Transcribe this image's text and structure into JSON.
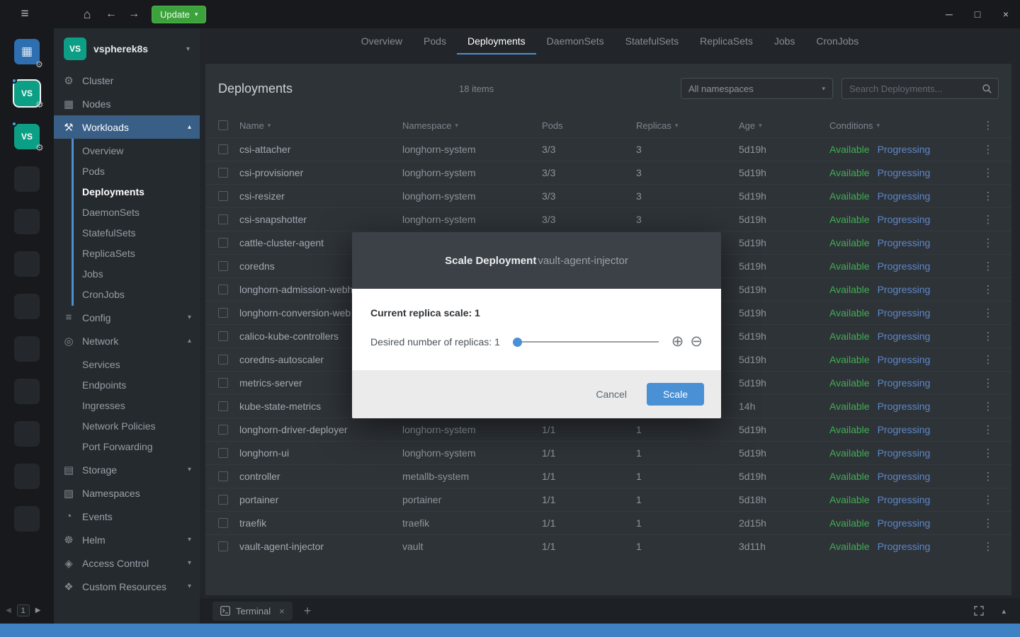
{
  "topbar": {
    "update_label": "Update"
  },
  "rail": {
    "active_cluster": "VS",
    "second_cluster": "VS",
    "page_number": "1"
  },
  "sidebar": {
    "cluster_initials": "VS",
    "cluster_name": "vspherek8s",
    "items": [
      {
        "id": "cluster",
        "label": "Cluster",
        "icon": "cluster-icon"
      },
      {
        "id": "nodes",
        "label": "Nodes",
        "icon": "nodes-icon"
      },
      {
        "id": "workloads",
        "label": "Workloads",
        "icon": "workloads-icon",
        "expanded": true,
        "active": true,
        "children": [
          "Overview",
          "Pods",
          "Deployments",
          "DaemonSets",
          "StatefulSets",
          "ReplicaSets",
          "Jobs",
          "CronJobs"
        ],
        "active_child": "Deployments"
      },
      {
        "id": "config",
        "label": "Config",
        "icon": "config-icon",
        "expanded": false
      },
      {
        "id": "network",
        "label": "Network",
        "icon": "network-icon",
        "expanded": true,
        "children": [
          "Services",
          "Endpoints",
          "Ingresses",
          "Network Policies",
          "Port Forwarding"
        ]
      },
      {
        "id": "storage",
        "label": "Storage",
        "icon": "storage-icon",
        "expanded": false
      },
      {
        "id": "namespaces",
        "label": "Namespaces",
        "icon": "namespaces-icon"
      },
      {
        "id": "events",
        "label": "Events",
        "icon": "events-icon"
      },
      {
        "id": "helm",
        "label": "Helm",
        "icon": "helm-icon",
        "expanded": false
      },
      {
        "id": "access-control",
        "label": "Access Control",
        "icon": "access-control-icon",
        "expanded": false
      },
      {
        "id": "custom-resources",
        "label": "Custom Resources",
        "icon": "custom-resources-icon",
        "expanded": false
      }
    ]
  },
  "tabs": {
    "active": "Deployments",
    "items": [
      "Overview",
      "Pods",
      "Deployments",
      "DaemonSets",
      "StatefulSets",
      "ReplicaSets",
      "Jobs",
      "CronJobs"
    ]
  },
  "toolbar": {
    "title": "Deployments",
    "items_count": "18 items",
    "namespace_filter": "All namespaces",
    "search_placeholder": "Search Deployments..."
  },
  "table": {
    "columns": [
      {
        "label": "Name",
        "sortable": true
      },
      {
        "label": "Namespace",
        "sortable": true
      },
      {
        "label": "Pods",
        "sortable": false
      },
      {
        "label": "Replicas",
        "sortable": true
      },
      {
        "label": "Age",
        "sortable": true
      },
      {
        "label": "Conditions",
        "sortable": true
      }
    ],
    "rows": [
      {
        "name": "csi-attacher",
        "namespace": "longhorn-system",
        "pods": "3/3",
        "replicas": "3",
        "age": "5d19h",
        "conditions": [
          "Available",
          "Progressing"
        ]
      },
      {
        "name": "csi-provisioner",
        "namespace": "longhorn-system",
        "pods": "3/3",
        "replicas": "3",
        "age": "5d19h",
        "conditions": [
          "Available",
          "Progressing"
        ]
      },
      {
        "name": "csi-resizer",
        "namespace": "longhorn-system",
        "pods": "3/3",
        "replicas": "3",
        "age": "5d19h",
        "conditions": [
          "Available",
          "Progressing"
        ]
      },
      {
        "name": "csi-snapshotter",
        "namespace": "longhorn-system",
        "pods": "3/3",
        "replicas": "3",
        "age": "5d19h",
        "conditions": [
          "Available",
          "Progressing"
        ]
      },
      {
        "name": "cattle-cluster-agent",
        "namespace": "",
        "pods": "",
        "replicas": "",
        "age": "5d19h",
        "conditions": [
          "Available",
          "Progressing"
        ]
      },
      {
        "name": "coredns",
        "namespace": "",
        "pods": "",
        "replicas": "",
        "age": "5d19h",
        "conditions": [
          "Available",
          "Progressing"
        ]
      },
      {
        "name": "longhorn-admission-webh",
        "namespace": "",
        "pods": "",
        "replicas": "",
        "age": "5d19h",
        "conditions": [
          "Available",
          "Progressing"
        ]
      },
      {
        "name": "longhorn-conversion-web",
        "namespace": "",
        "pods": "",
        "replicas": "",
        "age": "5d19h",
        "conditions": [
          "Available",
          "Progressing"
        ]
      },
      {
        "name": "calico-kube-controllers",
        "namespace": "",
        "pods": "",
        "replicas": "",
        "age": "5d19h",
        "conditions": [
          "Available",
          "Progressing"
        ]
      },
      {
        "name": "coredns-autoscaler",
        "namespace": "",
        "pods": "",
        "replicas": "",
        "age": "5d19h",
        "conditions": [
          "Available",
          "Progressing"
        ]
      },
      {
        "name": "metrics-server",
        "namespace": "",
        "pods": "",
        "replicas": "",
        "age": "5d19h",
        "conditions": [
          "Available",
          "Progressing"
        ]
      },
      {
        "name": "kube-state-metrics",
        "namespace": "",
        "pods": "",
        "replicas": "",
        "age": "14h",
        "conditions": [
          "Available",
          "Progressing"
        ]
      },
      {
        "name": "longhorn-driver-deployer",
        "namespace": "longhorn-system",
        "pods": "1/1",
        "replicas": "1",
        "age": "5d19h",
        "conditions": [
          "Available",
          "Progressing"
        ]
      },
      {
        "name": "longhorn-ui",
        "namespace": "longhorn-system",
        "pods": "1/1",
        "replicas": "1",
        "age": "5d19h",
        "conditions": [
          "Available",
          "Progressing"
        ]
      },
      {
        "name": "controller",
        "namespace": "metallb-system",
        "pods": "1/1",
        "replicas": "1",
        "age": "5d19h",
        "conditions": [
          "Available",
          "Progressing"
        ]
      },
      {
        "name": "portainer",
        "namespace": "portainer",
        "pods": "1/1",
        "replicas": "1",
        "age": "5d18h",
        "conditions": [
          "Available",
          "Progressing"
        ]
      },
      {
        "name": "traefik",
        "namespace": "traefik",
        "pods": "1/1",
        "replicas": "1",
        "age": "2d15h",
        "conditions": [
          "Available",
          "Progressing"
        ]
      },
      {
        "name": "vault-agent-injector",
        "namespace": "vault",
        "pods": "1/1",
        "replicas": "1",
        "age": "3d11h",
        "conditions": [
          "Available",
          "Progressing"
        ]
      }
    ]
  },
  "dialog": {
    "title": "Scale Deployment",
    "resource_name": "vault-agent-injector",
    "current_scale_text": "Current replica scale: 1",
    "desired_label": "Desired number of replicas: 1",
    "slider_value": 1,
    "cancel_label": "Cancel",
    "confirm_label": "Scale"
  },
  "dock": {
    "terminal_tab_label": "Terminal"
  },
  "colors": {
    "accent": "#4a90d5",
    "success": "#3faf52",
    "progressing": "#5e87c9",
    "statusbar_blue": "#3e82c4",
    "update_green": "#3ca23c",
    "cluster_tile_teal": "#0d9f85"
  }
}
